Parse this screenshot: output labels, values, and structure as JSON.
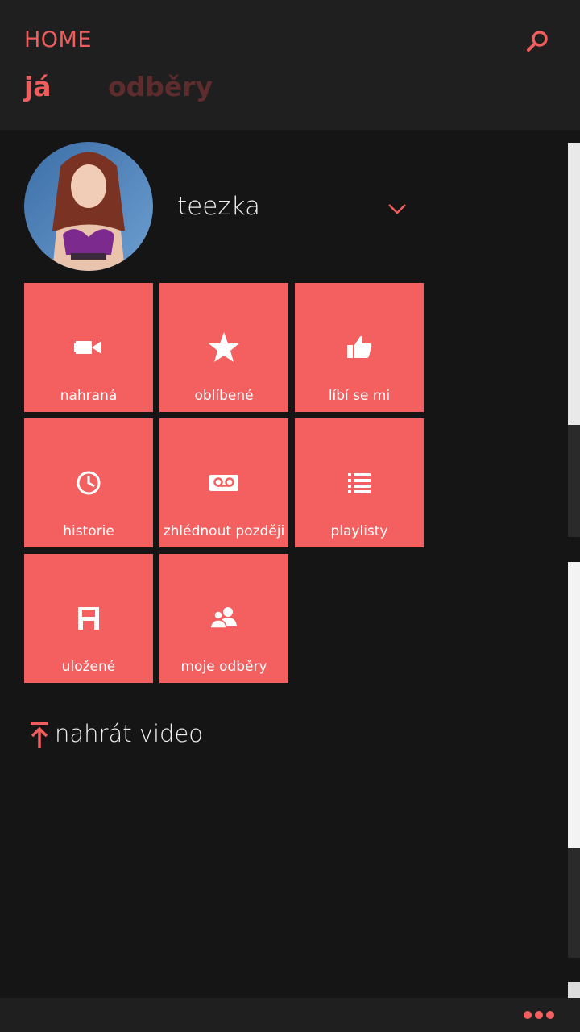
{
  "header": {
    "app_title": "HOME",
    "tabs": [
      {
        "label": "já",
        "active": true
      },
      {
        "label": "odběry",
        "active": false
      }
    ]
  },
  "profile": {
    "username": "teezka"
  },
  "tiles": [
    {
      "label": "nahraná",
      "icon": "video-camera-icon"
    },
    {
      "label": "oblíbené",
      "icon": "star-icon"
    },
    {
      "label": "líbí se mi",
      "icon": "thumbs-up-icon"
    },
    {
      "label": "historie",
      "icon": "clock-icon"
    },
    {
      "label": "zhlédnout později",
      "icon": "voicemail-icon"
    },
    {
      "label": "playlisty",
      "icon": "list-icon"
    },
    {
      "label": "uložené",
      "icon": "floppy-disk-icon"
    },
    {
      "label": "moje odběry",
      "icon": "people-icon"
    }
  ],
  "upload": {
    "label": "nahrát video",
    "icon": "upload-icon"
  },
  "colors": {
    "accent": "#f45f5f",
    "background": "#151515",
    "header": "#1f1f1f"
  }
}
